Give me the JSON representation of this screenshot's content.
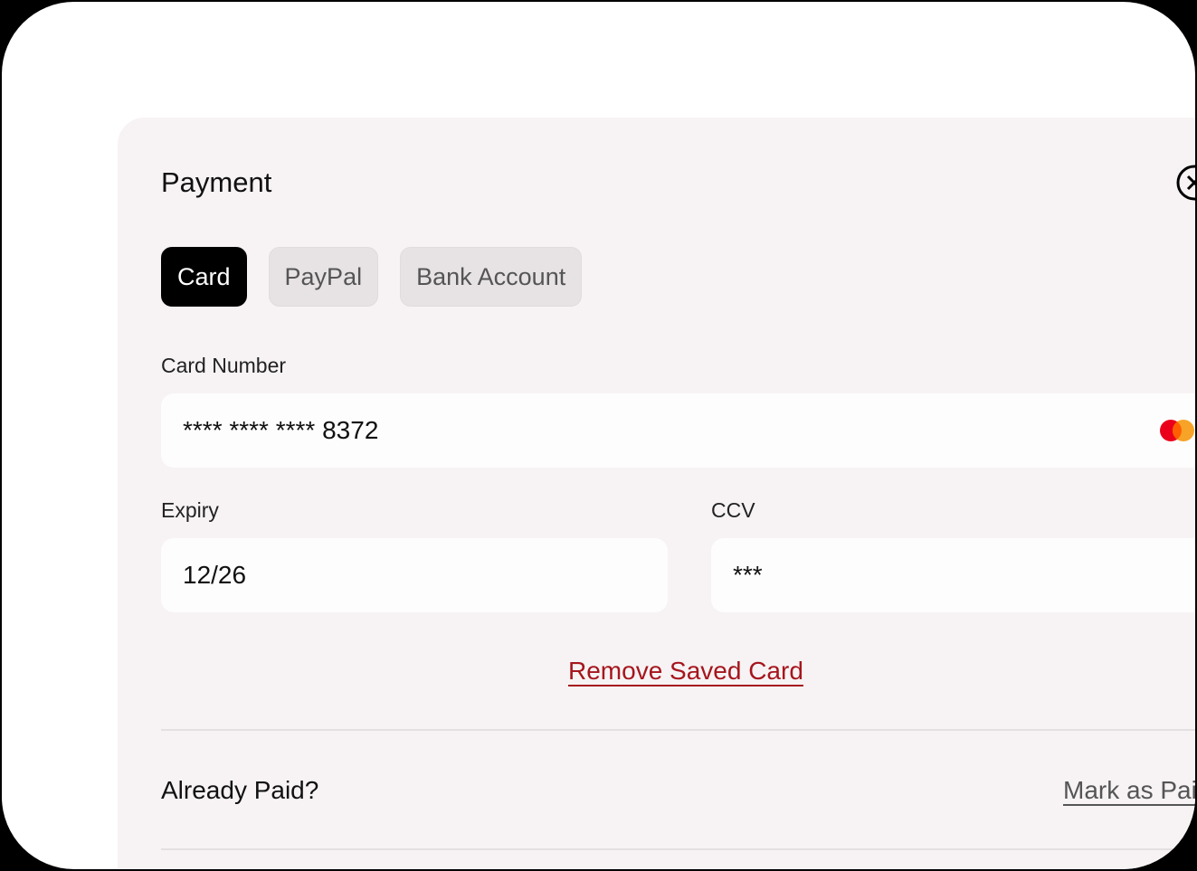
{
  "payment": {
    "title": "Payment",
    "tabs": [
      {
        "label": "Card"
      },
      {
        "label": "PayPal"
      },
      {
        "label": "Bank Account"
      }
    ],
    "card_number": {
      "label": "Card Number",
      "value": "**** **** **** 8372"
    },
    "expiry": {
      "label": "Expiry",
      "value": "12/26"
    },
    "ccv": {
      "label": "CCV",
      "value": "***"
    },
    "remove_label": "Remove Saved Card",
    "already_paid": "Already Paid?",
    "mark_as_paid": "Mark as Paid",
    "colors": {
      "accent": "#a5161d",
      "panel": "#f7f3f4"
    }
  }
}
